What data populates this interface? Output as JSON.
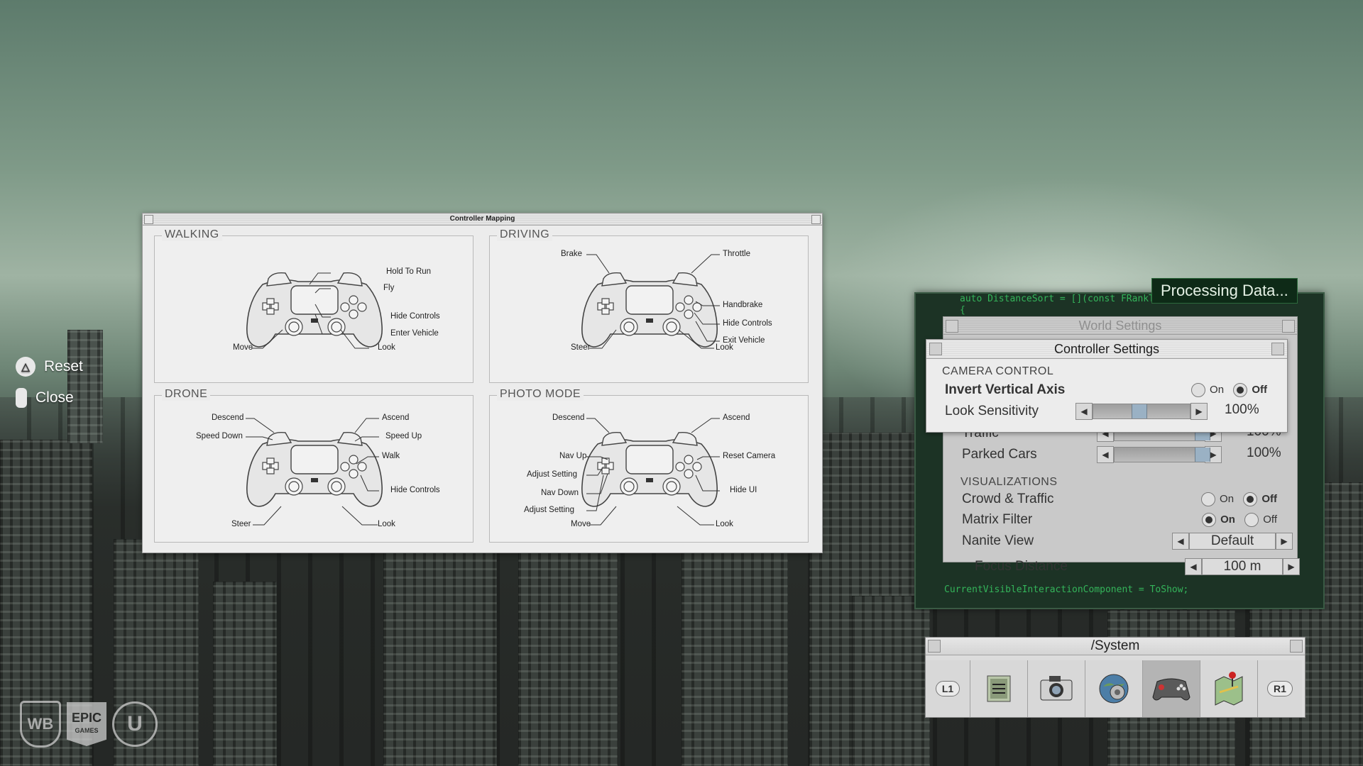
{
  "hints": {
    "reset": "Reset",
    "close": "Close"
  },
  "logos": {
    "wb": "WB",
    "epic": "EPIC",
    "epic_sub": "GAMES",
    "ue": "U"
  },
  "mapping": {
    "title": "Controller Mapping",
    "walking": {
      "title": "WALKING",
      "labels": [
        "Hold To Run",
        "Fly",
        "Hide Controls",
        "Enter Vehicle",
        "Move",
        "Look"
      ]
    },
    "driving": {
      "title": "DRIVING",
      "labels": [
        "Brake",
        "Throttle",
        "Handbrake",
        "Hide Controls",
        "Exit Vehicle",
        "Steer",
        "Look"
      ]
    },
    "drone": {
      "title": "DRONE",
      "labels": [
        "Descend",
        "Speed Down",
        "Ascend",
        "Speed Up",
        "Walk",
        "Hide Controls",
        "Steer",
        "Look"
      ]
    },
    "photo": {
      "title": "PHOTO MODE",
      "labels": [
        "Descend",
        "Nav Up",
        "Adjust Setting",
        "Nav Down",
        "Adjust Setting",
        "Move",
        "Ascend",
        "Reset Camera",
        "Hide UI",
        "Look"
      ]
    }
  },
  "code": {
    "line1": "auto DistanceSort = [](const FRankTypedEntry",
    "line2": "{",
    "line3": "CurrentVisibleInteractionComponent = ToShow;"
  },
  "processing": "Processing Data...",
  "world": {
    "title": "World Settings",
    "traffic": {
      "label": "Traffic",
      "value": "100%",
      "level": 0.9
    },
    "parked": {
      "label": "Parked Cars",
      "value": "100%",
      "level": 0.9
    },
    "vis_section": "VISUALIZATIONS",
    "crowd": {
      "label": "Crowd & Traffic",
      "on": "On",
      "off": "Off",
      "selected": "Off"
    },
    "matrix": {
      "label": "Matrix Filter",
      "on": "On",
      "off": "Off",
      "selected": "On"
    },
    "nanite": {
      "label": "Nanite View",
      "value": "Default"
    },
    "focus": {
      "label": "Focus Distance",
      "value": "100 m"
    }
  },
  "controller": {
    "title": "Controller Settings",
    "section": "CAMERA CONTROL",
    "invert": {
      "label": "Invert Vertical Axis",
      "on": "On",
      "off": "Off",
      "selected": "Off"
    },
    "sensitivity": {
      "label": "Look Sensitivity",
      "value": "100%",
      "level": 0.4
    }
  },
  "system": {
    "title": "/System",
    "l1": "L1",
    "r1": "R1",
    "icons": [
      "document-icon",
      "camera-icon",
      "settings-globe-icon",
      "gamepad-icon",
      "map-icon"
    ],
    "active": 3
  }
}
